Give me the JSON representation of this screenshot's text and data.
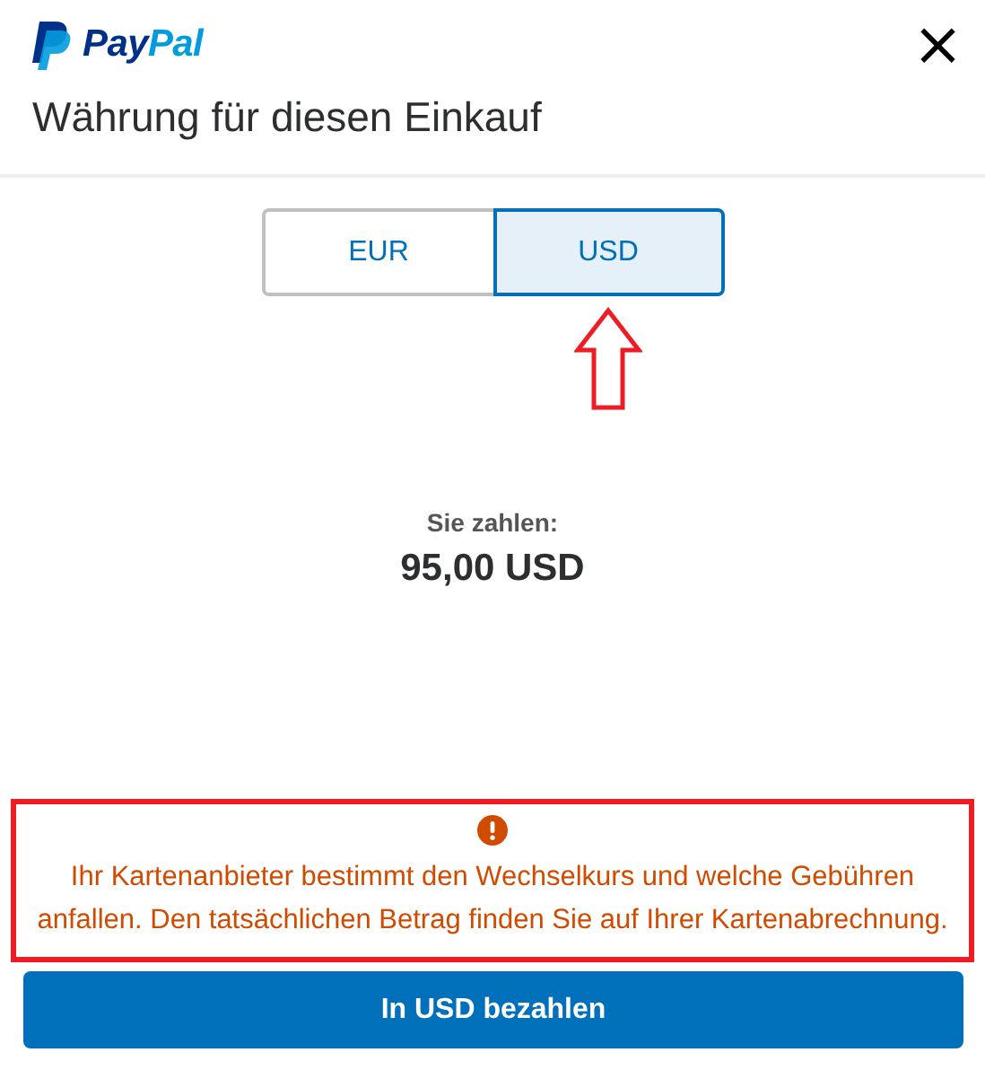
{
  "header": {
    "logo": [
      "Pay",
      "Pal"
    ],
    "close": "×",
    "title": "Währung für diesen Einkauf"
  },
  "currencies": [
    {
      "label": "EUR",
      "selected": false,
      "arrow_mark": false
    },
    {
      "label": "USD",
      "selected": true,
      "arrow_mark": true
    }
  ],
  "payment": {
    "label": "Sie zahlen:",
    "amount": "95,00 USD"
  },
  "notice": {
    "highlighted": true,
    "text": "Ihr Kartenanbieter bestimmt den Wechselkurs und welche Gebühren anfallen. Den tatsächlichen Betrag finden Sie auf Ihrer Kartenabrechnung."
  },
  "pay_button": "In USD bezahlen"
}
